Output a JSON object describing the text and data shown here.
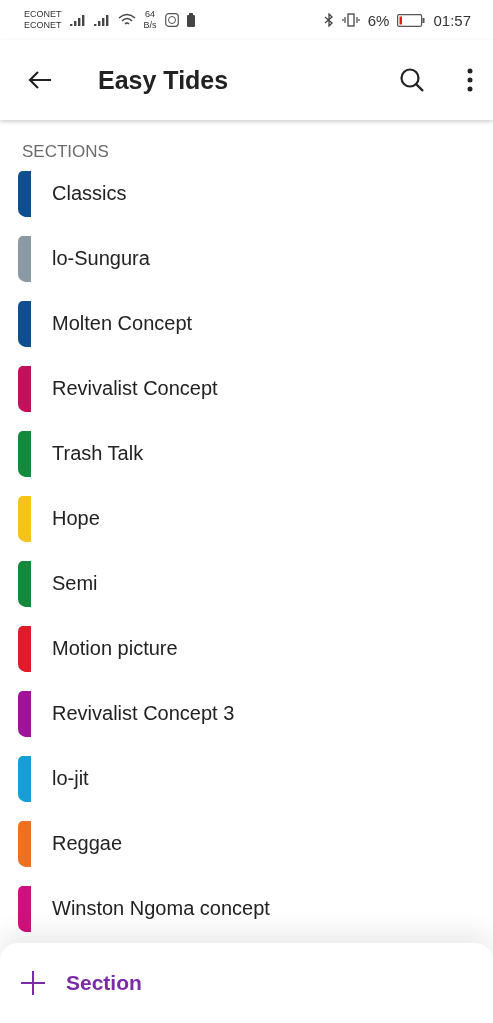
{
  "status_bar": {
    "carriers": [
      "ECONET",
      "ECONET"
    ],
    "net_speed": [
      "64",
      "B/s"
    ],
    "battery_percent": "6%",
    "time": "01:57"
  },
  "app_bar": {
    "title": "Easy Tides"
  },
  "sections_header": "SECTIONS",
  "sections": [
    {
      "name": "Classics",
      "color": "#0f4f8f"
    },
    {
      "name": "lo-Sungura",
      "color": "#8a9aa4"
    },
    {
      "name": "Molten Concept",
      "color": "#0f4f8f"
    },
    {
      "name": "Revivalist Concept",
      "color": "#c4105a"
    },
    {
      "name": "Trash Talk",
      "color": "#118a3c"
    },
    {
      "name": "Hope",
      "color": "#f7c21a"
    },
    {
      "name": "Semi",
      "color": "#118a3c"
    },
    {
      "name": "Motion picture",
      "color": "#e01b2a"
    },
    {
      "name": "Revivalist Concept 3",
      "color": "#a0129a"
    },
    {
      "name": "lo-jit",
      "color": "#159fd6"
    },
    {
      "name": "Reggae",
      "color": "#f07020"
    },
    {
      "name": "Winston Ngoma concept",
      "color": "#d0107e"
    }
  ],
  "add_button": {
    "label": "Section"
  }
}
